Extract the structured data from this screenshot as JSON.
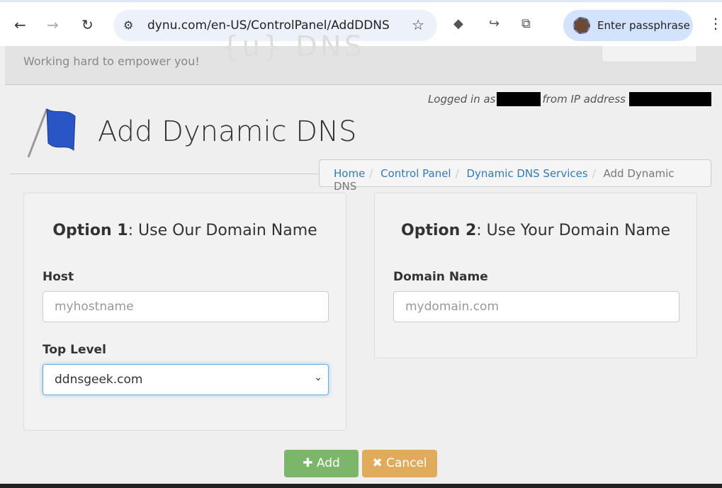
{
  "browser": {
    "url": "dynu.com/en-US/ControlPanel/AddDDNS",
    "profile_label": "Enter passphrase"
  },
  "header": {
    "tagline": "Working hard to empower you!",
    "logo_text": "{u} DNS"
  },
  "login": {
    "prefix": "Logged in as",
    "middle": "from IP address"
  },
  "page": {
    "title": "Add Dynamic DNS"
  },
  "breadcrumb": [
    "Home",
    "Control Panel",
    "Dynamic DNS Services",
    "Add Dynamic DNS"
  ],
  "option1": {
    "bold": "Option 1",
    "rest": ": Use Our Domain Name",
    "host_label": "Host",
    "host_placeholder": "myhostname",
    "top_label": "Top Level",
    "top_value": "ddnsgeek.com"
  },
  "option2": {
    "bold": "Option 2",
    "rest": ": Use Your Domain Name",
    "domain_label": "Domain Name",
    "domain_placeholder": "mydomain.com"
  },
  "buttons": {
    "add": "Add",
    "cancel": "Cancel"
  },
  "colors": {
    "add": "#7cb66a",
    "cancel": "#e0ac5c",
    "link": "#337ab7"
  }
}
